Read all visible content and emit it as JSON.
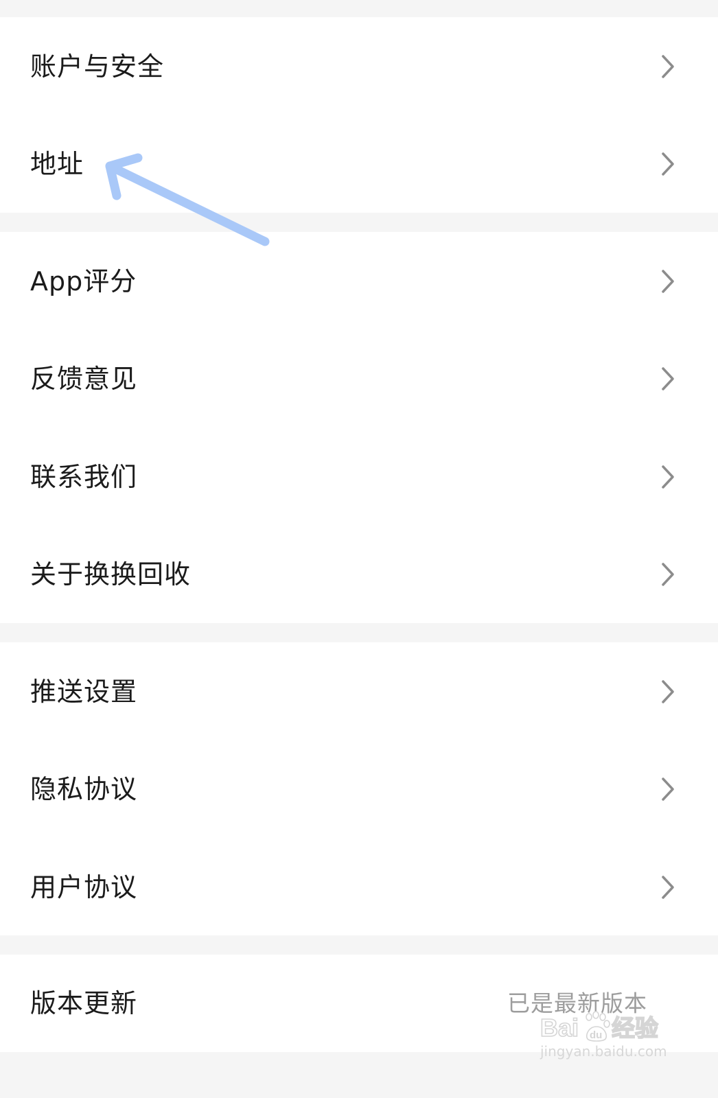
{
  "settings": {
    "groups": [
      {
        "items": [
          {
            "label": "账户与安全"
          },
          {
            "label": "地址"
          }
        ]
      },
      {
        "items": [
          {
            "label": "App评分"
          },
          {
            "label": "反馈意见"
          },
          {
            "label": "联系我们"
          },
          {
            "label": "关于换换回收"
          }
        ]
      },
      {
        "items": [
          {
            "label": "推送设置"
          },
          {
            "label": "隐私协议"
          },
          {
            "label": "用户协议"
          }
        ]
      },
      {
        "items": [
          {
            "label": "版本更新",
            "status": "已是最新版本"
          }
        ]
      }
    ]
  },
  "annotation": {
    "icon": "arrow-icon",
    "color": "#a9c8f8"
  },
  "watermark": {
    "logo_text": "Bai du 经验",
    "url": "jingyan.baidu.com"
  },
  "colors": {
    "background": "#f5f5f5",
    "card": "#ffffff",
    "text": "#1b1b1b",
    "chevron": "#8c8c8c",
    "status_text": "#9d9d9d"
  }
}
